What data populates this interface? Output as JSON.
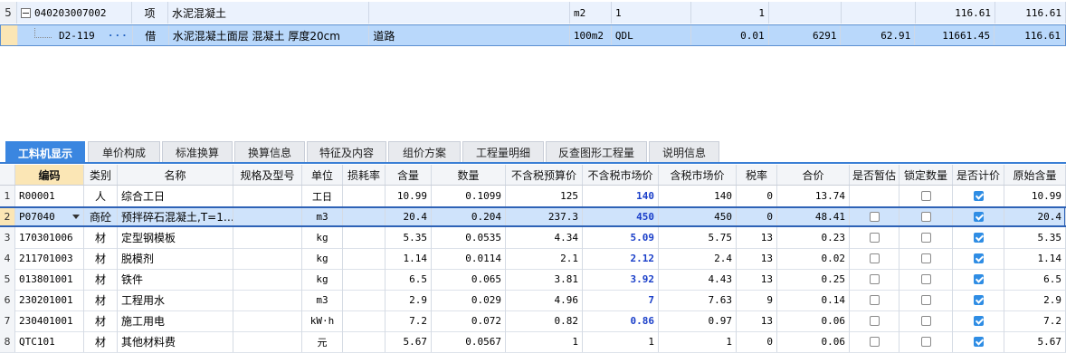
{
  "top_grid": {
    "rows": [
      {
        "rownum": "5",
        "code": "040203007002",
        "type": "项",
        "name": "水泥混凝土",
        "spec": "",
        "unit": "m2",
        "qty_expr": "1",
        "qty": "1",
        "price": "",
        "c8": "",
        "total": "116.61",
        "last": "116.61"
      },
      {
        "rownum": "",
        "code": "D2-119",
        "type": "借",
        "name": "水泥混凝土面层 混凝土 厚度20cm",
        "spec": "道路",
        "unit": "100m2",
        "qty_expr": "QDL",
        "qty": "0.01",
        "price": "6291",
        "c8": "62.91",
        "total": "11661.45",
        "last": "116.61"
      }
    ]
  },
  "tabs": [
    {
      "label": "工料机显示",
      "active": true
    },
    {
      "label": "单价构成",
      "active": false
    },
    {
      "label": "标准换算",
      "active": false
    },
    {
      "label": "换算信息",
      "active": false
    },
    {
      "label": "特征及内容",
      "active": false
    },
    {
      "label": "组价方案",
      "active": false
    },
    {
      "label": "工程量明细",
      "active": false
    },
    {
      "label": "反查图形工程量",
      "active": false
    },
    {
      "label": "说明信息",
      "active": false
    }
  ],
  "grid": {
    "headers": [
      "编码",
      "类别",
      "名称",
      "规格及型号",
      "单位",
      "损耗率",
      "含量",
      "数量",
      "不含税预算价",
      "不含税市场价",
      "含税市场价",
      "税率",
      "合价",
      "是否暂估",
      "锁定数量",
      "是否计价",
      "原始含量"
    ],
    "rows": [
      {
        "n": "1",
        "code": "R00001",
        "cat": "人",
        "name": "综合工日",
        "spec": "",
        "unit": "工日",
        "loss": "",
        "content": "10.99",
        "qty": "0.1099",
        "budget": "125",
        "market": "140",
        "taxmarket": "140",
        "tax": "0",
        "total": "13.74",
        "est": "none",
        "lock": false,
        "price": true,
        "orig": "10.99",
        "sel": false
      },
      {
        "n": "2",
        "code": "P07040",
        "cat": "商砼",
        "name": "预拌碎石混凝土,T=1…",
        "spec": "",
        "unit": "m3",
        "loss": "",
        "content": "20.4",
        "qty": "0.204",
        "budget": "237.3",
        "market": "450",
        "taxmarket": "450",
        "tax": "0",
        "total": "48.41",
        "est": false,
        "lock": false,
        "price": true,
        "orig": "20.4",
        "sel": true
      },
      {
        "n": "3",
        "code": "170301006",
        "cat": "材",
        "name": "定型钢模板",
        "spec": "",
        "unit": "kg",
        "loss": "",
        "content": "5.35",
        "qty": "0.0535",
        "budget": "4.34",
        "market": "5.09",
        "taxmarket": "5.75",
        "tax": "13",
        "total": "0.23",
        "est": false,
        "lock": false,
        "price": true,
        "orig": "5.35",
        "sel": false
      },
      {
        "n": "4",
        "code": "211701003",
        "cat": "材",
        "name": "脱模剂",
        "spec": "",
        "unit": "kg",
        "loss": "",
        "content": "1.14",
        "qty": "0.0114",
        "budget": "2.1",
        "market": "2.12",
        "taxmarket": "2.4",
        "tax": "13",
        "total": "0.02",
        "est": false,
        "lock": false,
        "price": true,
        "orig": "1.14",
        "sel": false
      },
      {
        "n": "5",
        "code": "013801001",
        "cat": "材",
        "name": "铁件",
        "spec": "",
        "unit": "kg",
        "loss": "",
        "content": "6.5",
        "qty": "0.065",
        "budget": "3.81",
        "market": "3.92",
        "taxmarket": "4.43",
        "tax": "13",
        "total": "0.25",
        "est": false,
        "lock": false,
        "price": true,
        "orig": "6.5",
        "sel": false
      },
      {
        "n": "6",
        "code": "230201001",
        "cat": "材",
        "name": "工程用水",
        "spec": "",
        "unit": "m3",
        "loss": "",
        "content": "2.9",
        "qty": "0.029",
        "budget": "4.96",
        "market": "7",
        "taxmarket": "7.63",
        "tax": "9",
        "total": "0.14",
        "est": false,
        "lock": false,
        "price": true,
        "orig": "2.9",
        "sel": false
      },
      {
        "n": "7",
        "code": "230401001",
        "cat": "材",
        "name": "施工用电",
        "spec": "",
        "unit": "kW·h",
        "loss": "",
        "content": "7.2",
        "qty": "0.072",
        "budget": "0.82",
        "market": "0.86",
        "taxmarket": "0.97",
        "tax": "13",
        "total": "0.06",
        "est": false,
        "lock": false,
        "price": true,
        "orig": "7.2",
        "sel": false
      },
      {
        "n": "8",
        "code": "QTC101",
        "cat": "材",
        "name": "其他材料费",
        "spec": "",
        "unit": "元",
        "loss": "",
        "content": "5.67",
        "qty": "0.0567",
        "budget": "1",
        "market": "1",
        "taxmarket": "1",
        "tax": "0",
        "total": "0.06",
        "est": false,
        "lock": false,
        "price": true,
        "orig": "5.67",
        "sel": false
      }
    ],
    "bold_market_rows": [
      "1",
      "2",
      "3",
      "4",
      "5",
      "6",
      "7"
    ]
  },
  "colors": {
    "accent": "#3a86e0",
    "selection": "#cfe3fb",
    "highlight_text": "#1a3fc9"
  },
  "icons": [
    "collapse-icon",
    "tree-line-icon",
    "ellipsis-icon",
    "dropdown-arrow-icon",
    "checkbox-icon"
  ]
}
